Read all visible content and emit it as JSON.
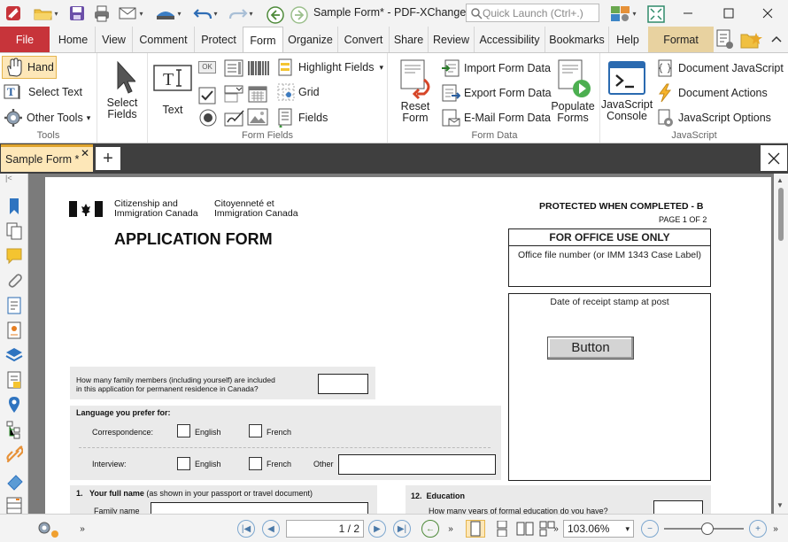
{
  "window": {
    "title": "Sample Form* - PDF-XChange ...",
    "quick_launch_placeholder": "Quick Launch (Ctrl+.)"
  },
  "ribbon_tabs": [
    {
      "label": "File"
    },
    {
      "label": "Home"
    },
    {
      "label": "View"
    },
    {
      "label": "Comment"
    },
    {
      "label": "Protect"
    },
    {
      "label": "Form"
    },
    {
      "label": "Organize"
    },
    {
      "label": "Convert"
    },
    {
      "label": "Share"
    },
    {
      "label": "Review"
    },
    {
      "label": "Accessibility"
    },
    {
      "label": "Bookmarks"
    },
    {
      "label": "Help"
    },
    {
      "label": "Format"
    }
  ],
  "ribbon": {
    "tools": {
      "label": "Tools",
      "hand": "Hand",
      "select_text": "Select Text",
      "other_tools": "Other Tools"
    },
    "select_fields": {
      "line1": "Select",
      "line2": "Fields"
    },
    "form_fields": {
      "label": "Form Fields",
      "text": "Text",
      "highlight_fields": "Highlight Fields",
      "grid": "Grid",
      "fields": "Fields",
      "ok_label": "OK"
    },
    "form_data": {
      "label": "Form Data",
      "reset_line1": "Reset",
      "reset_line2": "Form",
      "import": "Import Form Data",
      "export": "Export Form Data",
      "email": "E-Mail Form Data",
      "populate_line1": "Populate",
      "populate_line2": "Forms"
    },
    "javascript": {
      "label": "JavaScript",
      "console_line1": "JavaScript",
      "console_line2": "Console",
      "document_js": "Document JavaScript",
      "document_actions": "Document Actions",
      "js_options": "JavaScript Options"
    }
  },
  "doc_tab": {
    "label": "Sample Form *"
  },
  "form_page": {
    "dept_en_1": "Citizenship and",
    "dept_en_2": "Immigration Canada",
    "dept_fr_1": "Citoyenneté et",
    "dept_fr_2": "Immigration Canada",
    "protected": "PROTECTED WHEN COMPLETED - B",
    "page_of": "PAGE 1 OF 2",
    "title": "APPLICATION FORM",
    "office_use": "FOR OFFICE USE ONLY",
    "office_file": "Office file number (or IMM 1343 Case Label)",
    "receipt": "Date of receipt stamp at post",
    "button_label": "Button",
    "family_q1": "How many family members (including yourself) are included",
    "family_q2": "in this application for permanent residence in Canada?",
    "language_header": "Language you prefer for:",
    "correspondence": "Correspondence:",
    "interview": "Interview:",
    "english": "English",
    "french": "French",
    "other": "Other",
    "q1_num": "1.",
    "q1_label": "Your full name",
    "q1_hint": " (as shown in your passport or travel document)",
    "family_name": "Family name",
    "q12_num": "12.",
    "q12_label": "Education",
    "q12_sub": "How many years of formal education do you have?"
  },
  "status": {
    "page_input": "1",
    "page_total": "/ 2",
    "zoom": "103.06%"
  }
}
